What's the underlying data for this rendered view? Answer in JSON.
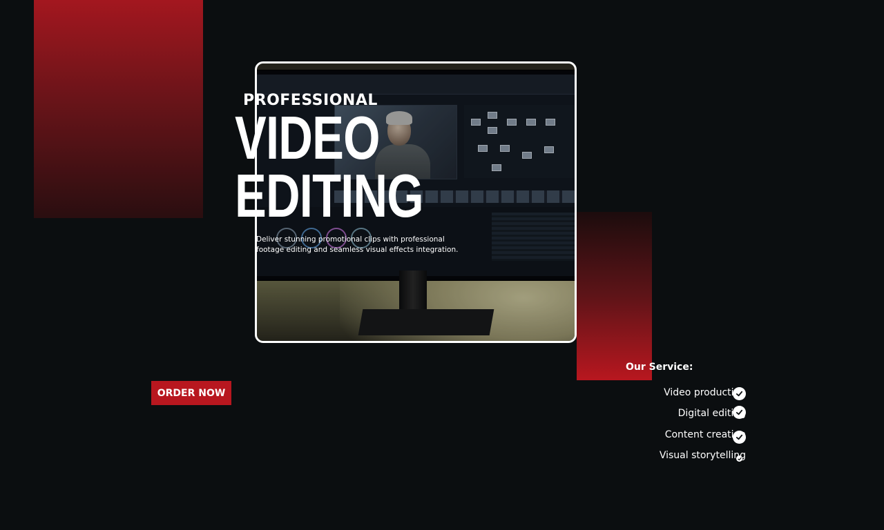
{
  "hero": {
    "kicker": "PROFESSIONAL",
    "title_line1": "VIDEO",
    "title_line2": "EDITING",
    "description": "Deliver stunning promotional clips with professional footage editing and seamless visual effects integration."
  },
  "cta": {
    "order_label": "ORDER NOW"
  },
  "services": {
    "title": "Our Service:",
    "items": [
      {
        "label": "Video production",
        "icon": "check-icon"
      },
      {
        "label": "Digital editing",
        "icon": "check-icon"
      },
      {
        "label": "Content creation",
        "icon": "check-icon"
      },
      {
        "label": "Visual storytelling",
        "icon": "check-icon"
      }
    ]
  },
  "colors": {
    "background": "#0b0e10",
    "accent_red": "#b8171f",
    "text": "#ffffff"
  }
}
